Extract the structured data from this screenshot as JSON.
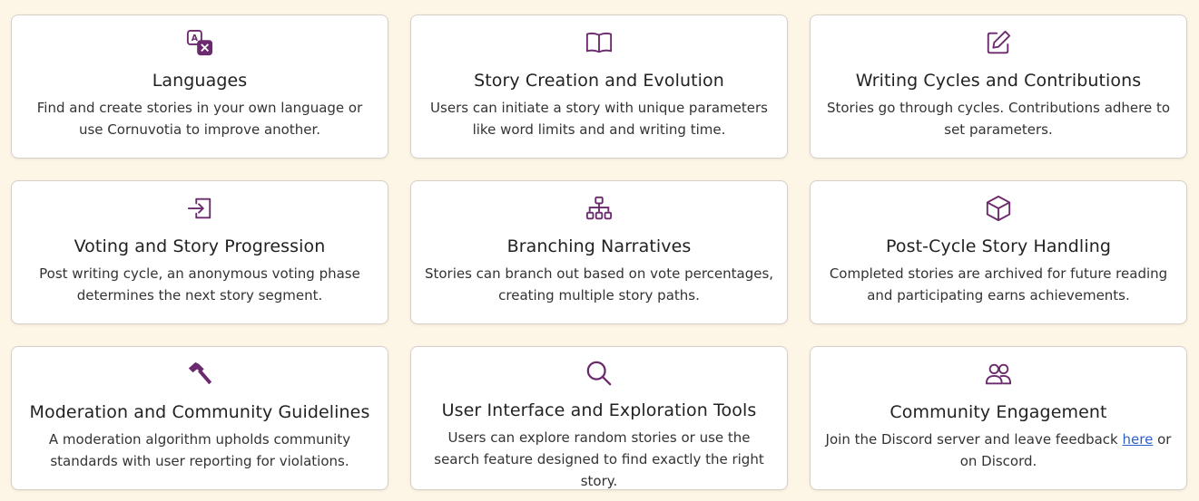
{
  "colors": {
    "background": "#fdf6e6",
    "accent": "#6b2a6d",
    "link": "#2a62c9"
  },
  "features": [
    {
      "icon": "language-icon",
      "title": "Languages",
      "description": "Find and create stories in your own language or use Cornuvotia to improve another."
    },
    {
      "icon": "open-book-icon",
      "title": "Story Creation and Evolution",
      "description": "Users can initiate a story with unique parameters like word limits and and writing time."
    },
    {
      "icon": "edit-pencil-icon",
      "title": "Writing Cycles and Contributions",
      "description": "Stories go through cycles. Contributions adhere to set parameters."
    },
    {
      "icon": "sign-in-arrow-icon",
      "title": "Voting and Story Progression",
      "description": "Post writing cycle, an anonymous voting phase determines the next story segment."
    },
    {
      "icon": "hierarchy-tree-icon",
      "title": "Branching Narratives",
      "description": "Stories can branch out based on vote percentages, creating multiple story paths."
    },
    {
      "icon": "cube-icon",
      "title": "Post-Cycle Story Handling",
      "description": "Completed stories are archived for future reading and participating earns achievements."
    },
    {
      "icon": "hammer-icon",
      "title": "Moderation and Community Guidelines",
      "description": "A moderation algorithm upholds community standards with user reporting for violations."
    },
    {
      "icon": "search-icon",
      "title": "User Interface and Exploration Tools",
      "description": "Users can explore random stories or use the search feature designed to find exactly the right story."
    },
    {
      "icon": "users-icon",
      "title": "Community Engagement",
      "description_before": "Join the Discord server and leave feedback ",
      "link_text": "here",
      "description_after": " or on Discord."
    }
  ]
}
